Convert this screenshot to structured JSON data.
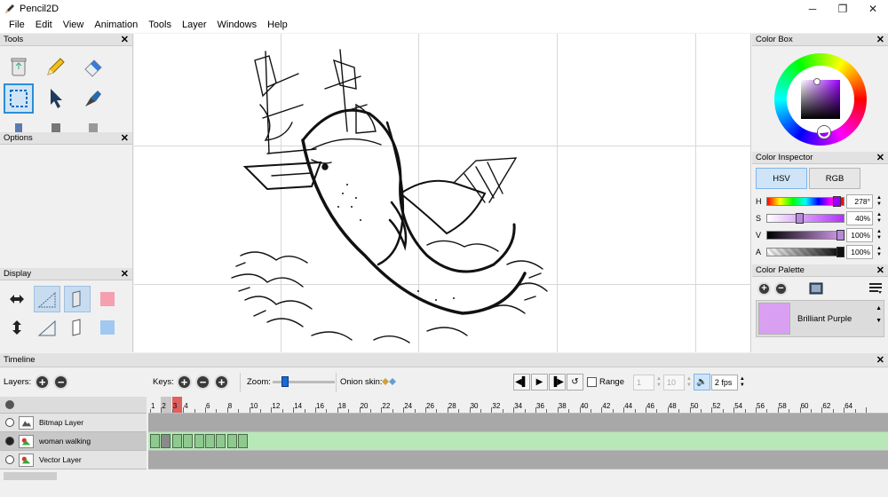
{
  "window": {
    "title": "Pencil2D"
  },
  "menu": [
    "File",
    "Edit",
    "View",
    "Animation",
    "Tools",
    "Layer",
    "Windows",
    "Help"
  ],
  "panels": {
    "tools": "Tools",
    "options": "Options",
    "display": "Display",
    "color_box": "Color Box",
    "color_inspector": "Color Inspector",
    "color_palette": "Color Palette",
    "timeline": "Timeline"
  },
  "close_glyph": "✕",
  "inspector": {
    "modes": [
      "HSV",
      "RGB"
    ],
    "selected_mode": "HSV",
    "H": {
      "label": "H",
      "value": "278°"
    },
    "S": {
      "label": "S",
      "value": "40%"
    },
    "V": {
      "label": "V",
      "value": "100%"
    },
    "A": {
      "label": "A",
      "value": "100%"
    }
  },
  "palette": {
    "item_name": "Brilliant Purple",
    "item_color": "#d9a0f2"
  },
  "timeline": {
    "layers_label": "Layers:",
    "keys_label": "Keys:",
    "zoom_label": "Zoom:",
    "onion_label": "Onion skin:",
    "range_label": "Range",
    "range_start": "1",
    "range_end": "10",
    "fps": "2 fps",
    "layers": [
      {
        "name": "Bitmap Layer",
        "type": "bitmap"
      },
      {
        "name": "woman walking",
        "type": "bitmap",
        "selected": true
      },
      {
        "name": "Vector Layer",
        "type": "vector"
      }
    ],
    "ruler_numbers": [
      "1",
      "2",
      "3",
      "4",
      "6",
      "8",
      "10",
      "12",
      "14",
      "16",
      "18",
      "20",
      "22",
      "24",
      "26",
      "28",
      "30",
      "32",
      "34",
      "36",
      "38",
      "40",
      "42",
      "44",
      "46",
      "48",
      "50",
      "52",
      "54",
      "56",
      "58",
      "60",
      "62",
      "64"
    ],
    "current_frame": 3,
    "keyframes_count": 9
  },
  "colors": {
    "accent": "#2a8ed8",
    "current_frame": "#e06060",
    "selected_track": "#b8e8b8"
  }
}
